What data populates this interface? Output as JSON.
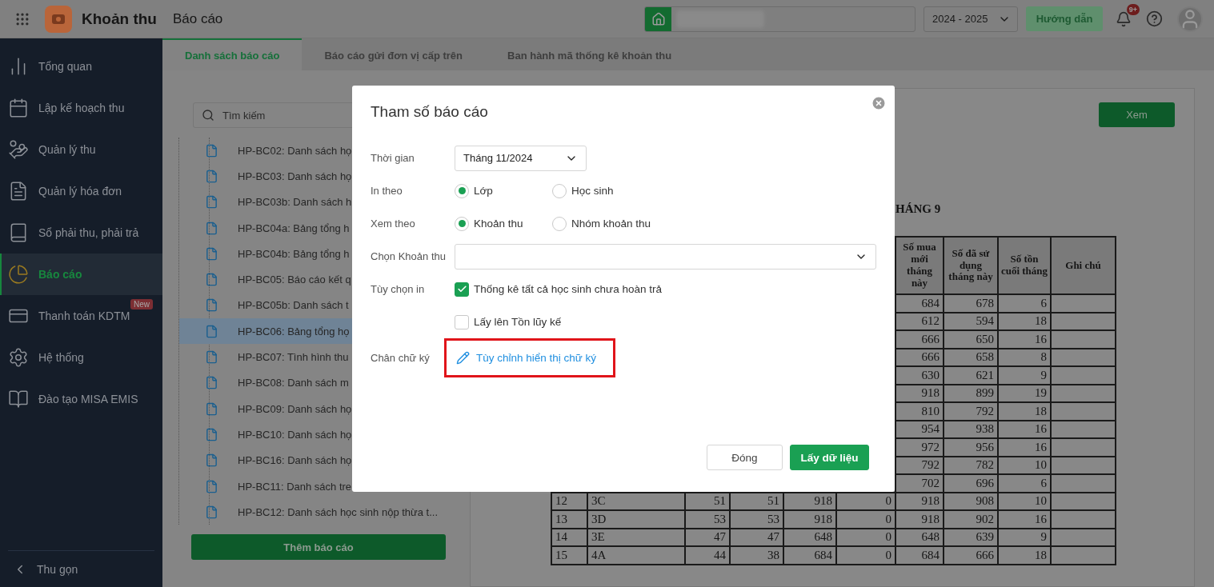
{
  "header": {
    "app_title": "Khoản thu",
    "page_title": "Báo cáo",
    "year": "2024 - 2025",
    "guide_button": "Hướng dẫn",
    "notification_badge": "9+"
  },
  "sidebar": {
    "items": [
      {
        "label": "Tổng quan",
        "selected": false
      },
      {
        "label": "Lập kế hoạch thu",
        "selected": false
      },
      {
        "label": "Quản lý thu",
        "selected": false
      },
      {
        "label": "Quản lý hóa đơn",
        "selected": false
      },
      {
        "label": "Sổ phải thu, phải trả",
        "selected": false
      },
      {
        "label": "Báo cáo",
        "selected": true
      },
      {
        "label": "Thanh toán KDTM",
        "selected": false,
        "badge": "New"
      },
      {
        "label": "Hệ thống",
        "selected": false
      },
      {
        "label": "Đào tạo MISA EMIS",
        "selected": false
      }
    ],
    "collapse": "Thu gọn"
  },
  "tabs": [
    {
      "label": "Danh sách báo cáo",
      "selected": true
    },
    {
      "label": "Báo cáo gửi đơn vị cấp trên",
      "selected": false
    },
    {
      "label": "Ban hành mã thống kê khoản thu",
      "selected": false
    }
  ],
  "report_list": {
    "search_placeholder": "Tìm kiếm",
    "items": [
      {
        "label": "HP-BC02: Danh sách họ",
        "selected": false
      },
      {
        "label": "HP-BC03: Danh sách họ",
        "selected": false
      },
      {
        "label": "HP-BC03b: Danh sách h",
        "selected": false
      },
      {
        "label": "HP-BC04a: Bảng tổng h",
        "selected": false
      },
      {
        "label": "HP-BC04b: Bảng tổng h",
        "selected": false
      },
      {
        "label": "HP-BC05: Báo cáo kết q",
        "selected": false
      },
      {
        "label": "HP-BC05b: Danh sách t",
        "selected": false
      },
      {
        "label": "HP-BC06: Bảng tổng họ",
        "selected": true
      },
      {
        "label": "HP-BC07: Tình hình thu",
        "selected": false
      },
      {
        "label": "HP-BC08: Danh sách m",
        "selected": false
      },
      {
        "label": "HP-BC09: Danh sách họ",
        "selected": false
      },
      {
        "label": "HP-BC10: Danh sách họ",
        "selected": false
      },
      {
        "label": "HP-BC16: Danh sách họ",
        "selected": false
      },
      {
        "label": "HP-BC11: Danh sách tre",
        "selected": false
      },
      {
        "label": "HP-BC12: Danh sách học sinh nộp thừa t...",
        "selected": false
      }
    ],
    "add_button": "Thêm báo cáo"
  },
  "preview": {
    "view_button": "Xem",
    "title": "HÁNG 9",
    "columns": [
      "Số mua mới tháng này",
      "Số đã sử dụng tháng này",
      "Số tồn cuối tháng",
      "Ghi chú"
    ],
    "upper_rows": [
      [
        "684",
        "678",
        "6"
      ],
      [
        "612",
        "594",
        "18"
      ],
      [
        "666",
        "650",
        "16"
      ],
      [
        "666",
        "658",
        "8"
      ],
      [
        "630",
        "621",
        "9"
      ],
      [
        "918",
        "899",
        "19"
      ],
      [
        "810",
        "792",
        "18"
      ],
      [
        "954",
        "938",
        "16"
      ],
      [
        "972",
        "956",
        "16"
      ],
      [
        "792",
        "782",
        "10"
      ],
      [
        "702",
        "696",
        "6"
      ]
    ],
    "lower_rows": [
      [
        "12",
        "3C",
        "51",
        "51",
        "918",
        "0",
        "918",
        "908",
        "10"
      ],
      [
        "13",
        "3D",
        "53",
        "53",
        "918",
        "0",
        "918",
        "902",
        "16"
      ],
      [
        "14",
        "3E",
        "47",
        "47",
        "648",
        "0",
        "648",
        "639",
        "9"
      ],
      [
        "15",
        "4A",
        "44",
        "38",
        "684",
        "0",
        "684",
        "666",
        "18"
      ]
    ]
  },
  "dialog": {
    "title": "Tham số báo cáo",
    "time": {
      "label": "Thời gian",
      "value": "Tháng 11/2024"
    },
    "print_by": {
      "label": "In theo",
      "options": [
        {
          "label": "Lớp",
          "selected": true
        },
        {
          "label": "Học sinh",
          "selected": false
        }
      ]
    },
    "view_by": {
      "label": "Xem theo",
      "options": [
        {
          "label": "Khoản thu",
          "selected": true
        },
        {
          "label": "Nhóm khoản thu",
          "selected": false
        }
      ]
    },
    "fee_select": {
      "label": "Chọn Khoản thu"
    },
    "print_options": {
      "label": "Tùy chọn in",
      "options": [
        {
          "label": "Thống kê tất cả học sinh chưa hoàn trả",
          "checked": true
        },
        {
          "label": "Lấy lên Tồn lũy kế",
          "checked": false
        }
      ]
    },
    "signature": {
      "label": "Chân chữ ký",
      "link": "Tùy chỉnh hiển thị chữ ký",
      "highlighted": true
    },
    "buttons": [
      {
        "label": "Đóng",
        "kind": "secondary"
      },
      {
        "label": "Lấy dữ liệu",
        "kind": "primary"
      }
    ]
  }
}
